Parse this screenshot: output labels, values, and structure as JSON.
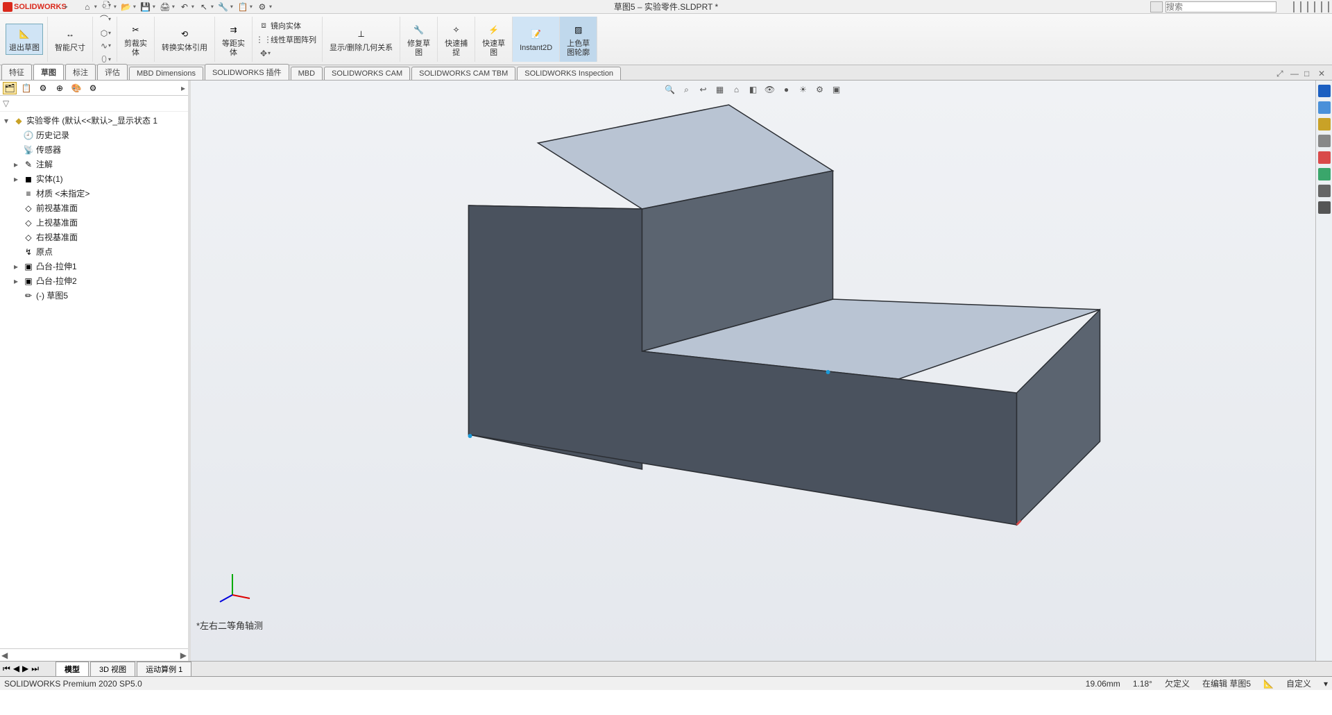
{
  "app": {
    "logo_text": "SOLIDWORKS",
    "doc_title": "草图5 – 实验零件.SLDPRT *",
    "search_placeholder": "搜索"
  },
  "qat": [
    {
      "name": "home-icon",
      "glyph": "⌂"
    },
    {
      "name": "new-icon",
      "glyph": "🗋"
    },
    {
      "name": "open-icon",
      "glyph": "📂"
    },
    {
      "name": "save-icon",
      "glyph": "💾"
    },
    {
      "name": "print-icon",
      "glyph": "🖨"
    },
    {
      "name": "undo-icon",
      "glyph": "↶"
    },
    {
      "name": "select-icon",
      "glyph": "↖"
    },
    {
      "name": "rebuild-icon",
      "glyph": "🔧"
    },
    {
      "name": "options-icon",
      "glyph": "📋"
    },
    {
      "name": "settings-icon",
      "glyph": "⚙"
    }
  ],
  "ribbon": {
    "exit_sketch": "退出草图",
    "smart_dim": "智能尺寸",
    "trim_ent": "剪裁实\n体",
    "convert_ent": "转换实体引用",
    "offset_ent": "等距实\n体",
    "mirror": "镜向实体",
    "linear_pattern": "线性草图阵列",
    "display_rel": "显示/删除几何关系",
    "repair": "修复草\n图",
    "quick_snap": "快速捕\n捉",
    "rapid": "快速草\n图",
    "instant2d": "Instant2D",
    "contour": "上色草\n图轮廓"
  },
  "cmd_tabs": [
    "特征",
    "草图",
    "标注",
    "评估",
    "MBD Dimensions",
    "SOLIDWORKS 插件",
    "MBD",
    "SOLIDWORKS CAM",
    "SOLIDWORKS CAM TBM",
    "SOLIDWORKS Inspection"
  ],
  "active_cmd_tab": 1,
  "tree": {
    "root": "实验零件 (默认<<默认>_显示状态 1",
    "items": [
      {
        "icon": "history-icon",
        "label": "历史记录",
        "glyph": "🕘"
      },
      {
        "icon": "sensors-icon",
        "label": "传感器",
        "glyph": "📡"
      },
      {
        "icon": "annotations-icon",
        "label": "注解",
        "glyph": "✎",
        "expand": "▸"
      },
      {
        "icon": "solid-body-icon",
        "label": "实体(1)",
        "glyph": "◼",
        "expand": "▸"
      },
      {
        "icon": "material-icon",
        "label": "材质 <未指定>",
        "glyph": "≡"
      },
      {
        "icon": "plane-icon",
        "label": "前视基准面",
        "glyph": "◇"
      },
      {
        "icon": "plane-icon",
        "label": "上视基准面",
        "glyph": "◇"
      },
      {
        "icon": "plane-icon",
        "label": "右视基准面",
        "glyph": "◇"
      },
      {
        "icon": "origin-icon",
        "label": "原点",
        "glyph": "↯"
      },
      {
        "icon": "extrude-icon",
        "label": "凸台-拉伸1",
        "glyph": "▣",
        "expand": "▸"
      },
      {
        "icon": "extrude-icon",
        "label": "凸台-拉伸2",
        "glyph": "▣",
        "expand": "▸"
      },
      {
        "icon": "sketch-icon",
        "label": "(-) 草图5",
        "glyph": "✏"
      }
    ]
  },
  "hud_icons": [
    {
      "name": "zoom-fit-icon",
      "glyph": "🔍"
    },
    {
      "name": "zoom-area-icon",
      "glyph": "⌕"
    },
    {
      "name": "prev-view-icon",
      "glyph": "↩"
    },
    {
      "name": "section-icon",
      "glyph": "▦"
    },
    {
      "name": "view-orient-icon",
      "glyph": "⌂"
    },
    {
      "name": "display-style-icon",
      "glyph": "◧"
    },
    {
      "name": "hide-show-icon",
      "glyph": "👁"
    },
    {
      "name": "appearance-icon",
      "glyph": "●"
    },
    {
      "name": "scene-icon",
      "glyph": "☀"
    },
    {
      "name": "view-settings-icon",
      "glyph": "⚙"
    },
    {
      "name": "view-cube-icon",
      "glyph": "▣"
    }
  ],
  "taskpane_icons": [
    {
      "name": "swx-res-icon",
      "color": "#1b5fc1"
    },
    {
      "name": "design-lib-icon",
      "color": "#4a90d9"
    },
    {
      "name": "file-explorer-icon",
      "color": "#c9a227"
    },
    {
      "name": "view-palette-icon",
      "color": "#888"
    },
    {
      "name": "appearances-icon",
      "color": "#d94a4a"
    },
    {
      "name": "custom-props-icon",
      "color": "#3aa66b"
    },
    {
      "name": "forum-icon",
      "color": "#666"
    },
    {
      "name": "cam-icon",
      "color": "#555"
    }
  ],
  "view_name": "*左右二等角轴测",
  "bottom_tabs": [
    "模型",
    "3D 视图",
    "运动算例 1"
  ],
  "active_bottom_tab": 0,
  "status": {
    "left": "SOLIDWORKS Premium 2020 SP5.0",
    "length": "19.06mm",
    "angle": "1.18°",
    "def": "欠定义",
    "editing": "在编辑 草图5",
    "custom": "自定义"
  }
}
